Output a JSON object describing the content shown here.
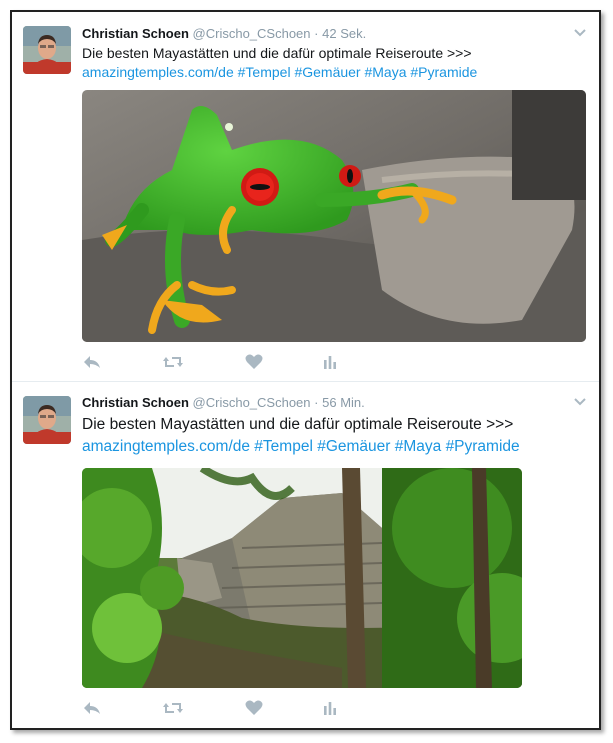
{
  "tweets": [
    {
      "author": "Christian Schoen",
      "handle": "@Crischo_CSchoen",
      "separator": "·",
      "time": "42 Sek.",
      "text_line1": "Die besten Mayastätten und die dafür optimale Reiseroute >>>",
      "link": "amazingtemples.com/de",
      "hashtags": " #Tempel #Gemäuer #Maya #Pyramide",
      "media_icon": "red-eyed-tree-frog-photo"
    },
    {
      "author": "Christian Schoen",
      "handle": "@Crischo_CSchoen",
      "separator": "·",
      "time": "56 Min.",
      "text_line1": "Die besten Mayastätten und die dafür optimale Reiseroute >>>",
      "link": "amazingtemples.com/de",
      "hashtags": " #Tempel #Gemäuer #Maya #Pyramide",
      "media_icon": "maya-ruin-jungle-photo"
    }
  ],
  "colors": {
    "link": "#1b95e0",
    "muted": "#8899a6",
    "action_icon": "#aab8c2"
  }
}
